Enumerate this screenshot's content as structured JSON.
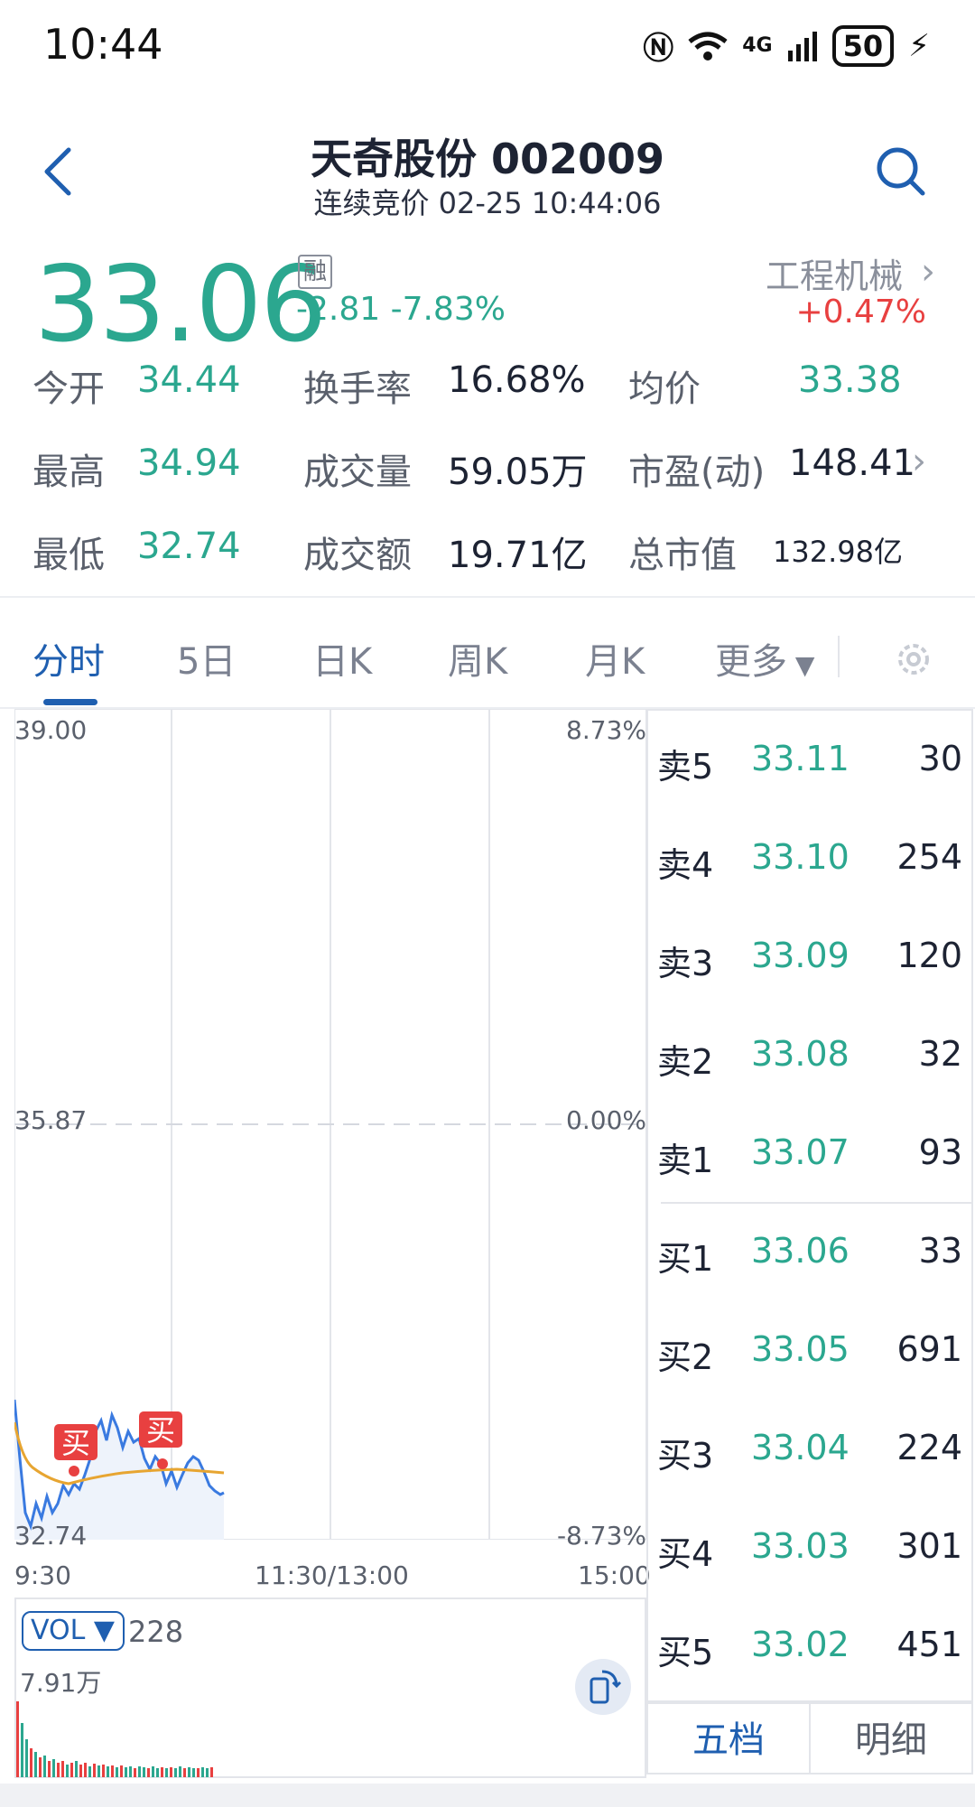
{
  "status_bar": {
    "time": "10:44",
    "network": "4G",
    "battery": "50"
  },
  "header": {
    "title": "天奇股份 002009",
    "subtitle": "连续竞价 02-25 10:44:06"
  },
  "quote": {
    "price": "33.06",
    "margin_badge": "融",
    "change": "-2.81 -7.83%",
    "industry": "工程机械",
    "industry_change": "+0.47%"
  },
  "stats": [
    {
      "label": "今开",
      "value": "34.44"
    },
    {
      "label": "换手率",
      "value": "16.68%"
    },
    {
      "label": "均价",
      "value": "33.38"
    },
    {
      "label": "最高",
      "value": "34.94"
    },
    {
      "label": "成交量",
      "value": "59.05万"
    },
    {
      "label": "市盈(动)",
      "value": "148.41"
    },
    {
      "label": "最低",
      "value": "32.74"
    },
    {
      "label": "成交额",
      "value": "19.71亿"
    },
    {
      "label": "总市值",
      "value": "132.98亿"
    }
  ],
  "tabs": [
    "分时",
    "5日",
    "日K",
    "周K",
    "月K",
    "更多"
  ],
  "chart_axis": {
    "price_top": "39.00",
    "price_mid": "35.87",
    "price_bottom": "32.74",
    "pct_top": "8.73%",
    "pct_mid": "0.00%",
    "pct_bottom": "-8.73%",
    "time_start": "9:30",
    "time_mid": "11:30/13:00",
    "time_end": "15:00",
    "vol_label": "VOL",
    "vol_value": "228",
    "vol_max": "7.91万",
    "buy_marker": "买"
  },
  "colors": {
    "green": "#2ba78f",
    "red": "#e84040",
    "blue": "#1f5fb0",
    "avg_line": "#e7a531"
  },
  "order_book": {
    "sell": [
      {
        "label": "卖5",
        "price": "33.11",
        "vol": "30"
      },
      {
        "label": "卖4",
        "price": "33.10",
        "vol": "254"
      },
      {
        "label": "卖3",
        "price": "33.09",
        "vol": "120"
      },
      {
        "label": "卖2",
        "price": "33.08",
        "vol": "32"
      },
      {
        "label": "卖1",
        "price": "33.07",
        "vol": "93"
      }
    ],
    "buy": [
      {
        "label": "买1",
        "price": "33.06",
        "vol": "33"
      },
      {
        "label": "买2",
        "price": "33.05",
        "vol": "691"
      },
      {
        "label": "买3",
        "price": "33.04",
        "vol": "224"
      },
      {
        "label": "买4",
        "price": "33.03",
        "vol": "301"
      },
      {
        "label": "买5",
        "price": "33.02",
        "vol": "451"
      }
    ],
    "tab_level": "五档",
    "tab_detail": "明细"
  }
}
